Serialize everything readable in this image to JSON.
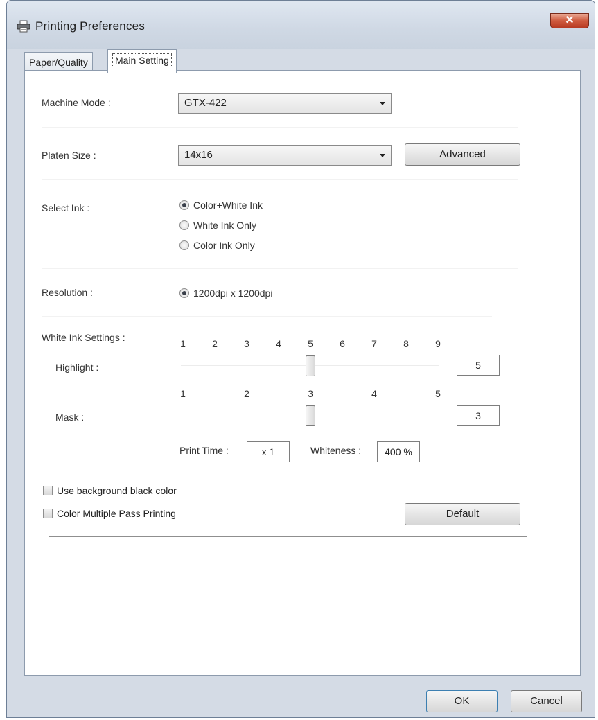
{
  "window": {
    "title": "Printing Preferences",
    "icon": "printer-icon",
    "close_glyph": "✕"
  },
  "tabs": [
    {
      "label": "Paper/Quality",
      "active": false
    },
    {
      "label": "Main Setting",
      "active": true
    }
  ],
  "machine_mode": {
    "label": "Machine Mode :",
    "value": "GTX-422"
  },
  "platen_size": {
    "label": "Platen Size :",
    "value": "14x16",
    "advanced_label": "Advanced"
  },
  "select_ink": {
    "label": "Select Ink :",
    "options": [
      {
        "label": "Color+White Ink",
        "checked": true
      },
      {
        "label": "White Ink Only",
        "checked": false
      },
      {
        "label": "Color Ink Only",
        "checked": false
      }
    ]
  },
  "resolution": {
    "label": "Resolution :",
    "option": "1200dpi x 1200dpi"
  },
  "white_ink": {
    "label": "White Ink Settings :",
    "highlight": {
      "label": "Highlight :",
      "ticks": [
        "1",
        "2",
        "3",
        "4",
        "5",
        "6",
        "7",
        "8",
        "9"
      ],
      "value": "5",
      "level": 5
    },
    "mask": {
      "label": "Mask :",
      "ticks": [
        "1",
        "2",
        "3",
        "4",
        "5"
      ],
      "value": "3",
      "level": 3
    },
    "print_time_label": "Print Time :",
    "print_time_value": "x 1",
    "whiteness_label": "Whiteness :",
    "whiteness_value": "400 %"
  },
  "options": {
    "use_black_bg": "Use background black color",
    "color_multi_pass": "Color Multiple Pass Printing",
    "default_label": "Default"
  },
  "footer": {
    "ok_label": "OK",
    "cancel_label": "Cancel"
  },
  "colors": {
    "window_chrome": "#d4dbe5",
    "close_button": "#cf5b3f",
    "panel_background": "#ffffff"
  }
}
